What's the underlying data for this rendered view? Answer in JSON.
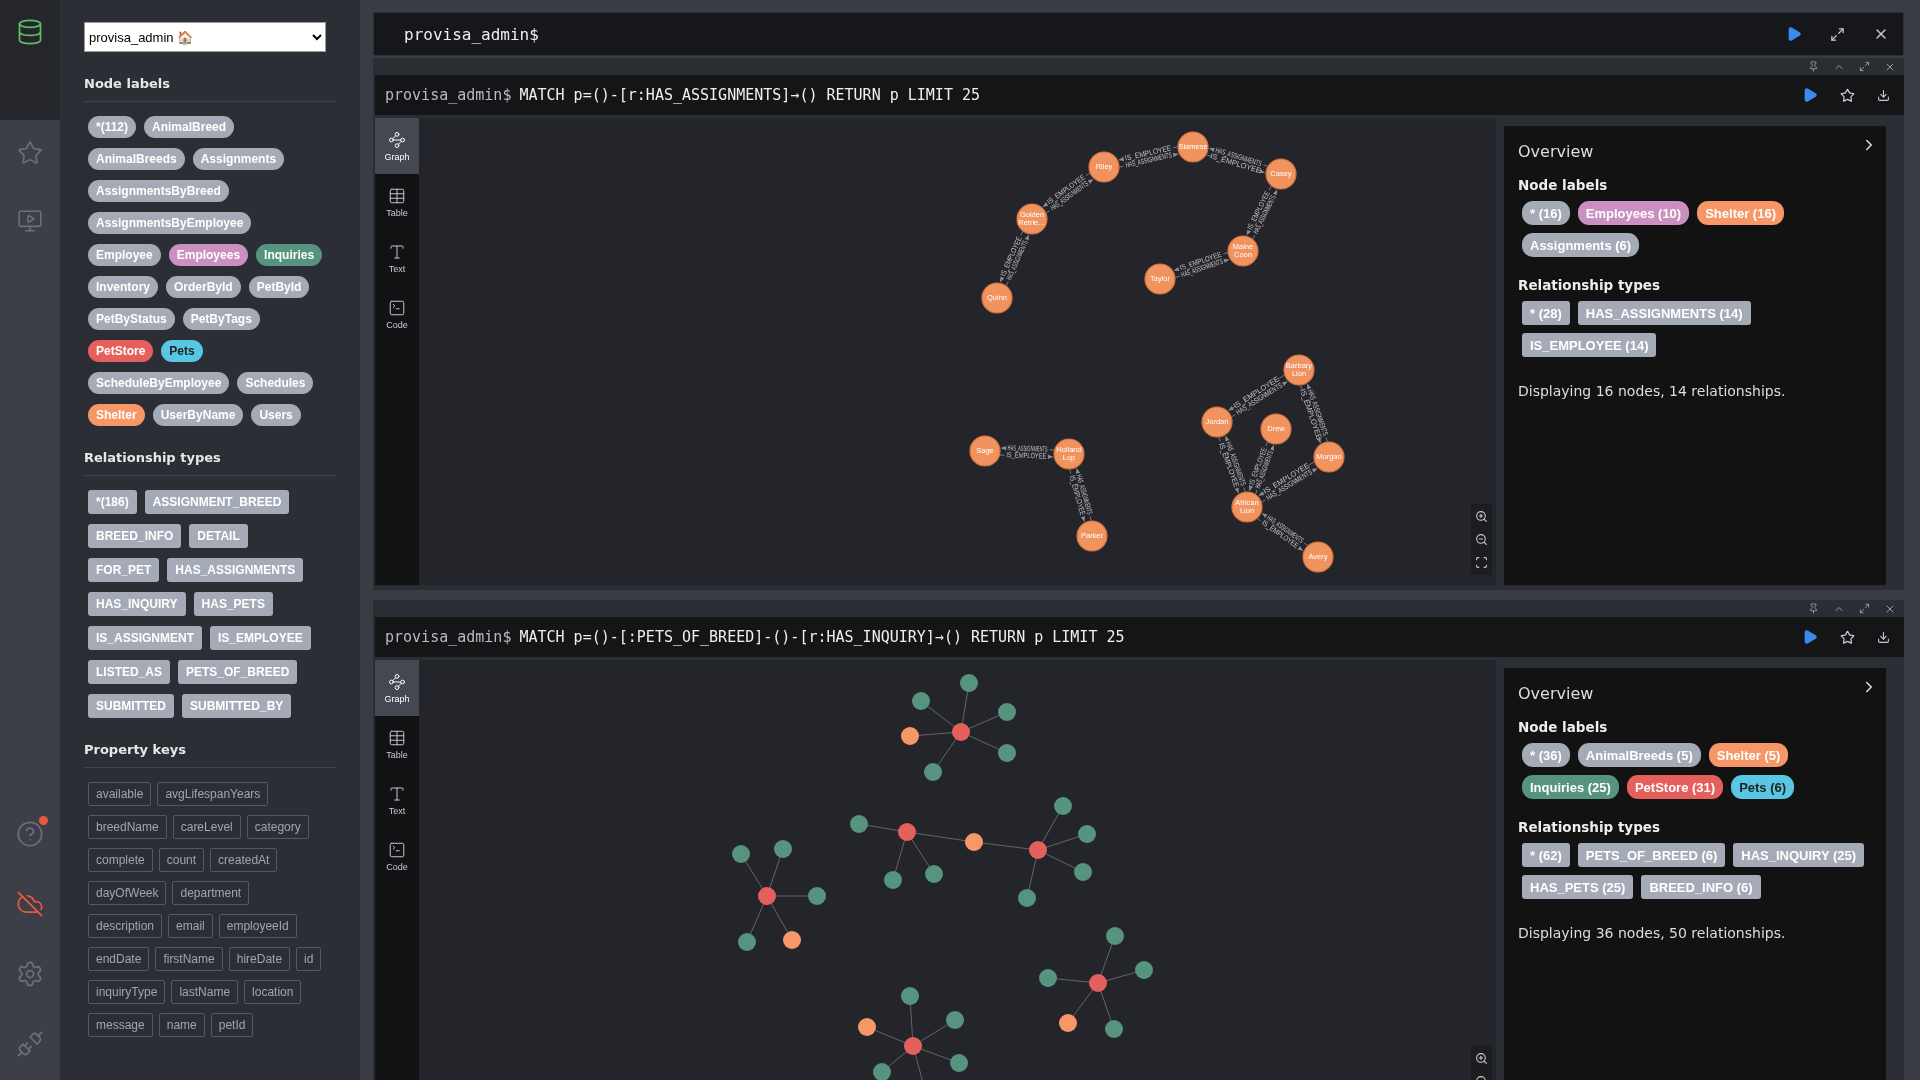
{
  "database_select": {
    "value": "provisa_admin 🏠"
  },
  "sidebar": {
    "sections": [
      {
        "kind": "labels",
        "title": "Node labels",
        "items": [
          {
            "text": "*(112)",
            "color": "#a5abb6"
          },
          {
            "text": "AnimalBreed",
            "color": "#a5abb6"
          },
          {
            "text": "AnimalBreeds",
            "color": "#a5abb6"
          },
          {
            "text": "Assignments",
            "color": "#a5abb6"
          },
          {
            "text": "AssignmentsByBreed",
            "color": "#a5abb6"
          },
          {
            "text": "AssignmentsByEmployee",
            "color": "#a5abb6"
          },
          {
            "text": "Employee",
            "color": "#a5abb6"
          },
          {
            "text": "Employees",
            "color": "#c990c0"
          },
          {
            "text": "Inquiries",
            "color": "#569480"
          },
          {
            "text": "Inventory",
            "color": "#a5abb6"
          },
          {
            "text": "OrderById",
            "color": "#a5abb6"
          },
          {
            "text": "PetById",
            "color": "#a5abb6"
          },
          {
            "text": "PetByStatus",
            "color": "#a5abb6"
          },
          {
            "text": "PetByTags",
            "color": "#a5abb6"
          },
          {
            "text": "PetStore",
            "color": "#e5605c"
          },
          {
            "text": "Pets",
            "color": "#57c7e3"
          },
          {
            "text": "ScheduleByEmployee",
            "color": "#a5abb6"
          },
          {
            "text": "Schedules",
            "color": "#a5abb6"
          },
          {
            "text": "Shelter",
            "color": "#f79767"
          },
          {
            "text": "UserByName",
            "color": "#a5abb6"
          },
          {
            "text": "Users",
            "color": "#a5abb6"
          }
        ]
      },
      {
        "kind": "types",
        "title": "Relationship types",
        "items": [
          {
            "text": "*(186)"
          },
          {
            "text": "ASSIGNMENT_BREED"
          },
          {
            "text": "BREED_INFO"
          },
          {
            "text": "DETAIL"
          },
          {
            "text": "FOR_PET"
          },
          {
            "text": "HAS_ASSIGNMENTS"
          },
          {
            "text": "HAS_INQUIRY"
          },
          {
            "text": "HAS_PETS"
          },
          {
            "text": "IS_ASSIGNMENT"
          },
          {
            "text": "IS_EMPLOYEE"
          },
          {
            "text": "LISTED_AS"
          },
          {
            "text": "PETS_OF_BREED"
          },
          {
            "text": "SUBMITTED"
          },
          {
            "text": "SUBMITTED_BY"
          }
        ]
      },
      {
        "kind": "keys",
        "title": "Property keys",
        "items": [
          {
            "text": "available"
          },
          {
            "text": "avgLifespanYears"
          },
          {
            "text": "breedName"
          },
          {
            "text": "careLevel"
          },
          {
            "text": "category"
          },
          {
            "text": "complete"
          },
          {
            "text": "count"
          },
          {
            "text": "createdAt"
          },
          {
            "text": "dayOfWeek"
          },
          {
            "text": "department"
          },
          {
            "text": "description"
          },
          {
            "text": "email"
          },
          {
            "text": "employeeId"
          },
          {
            "text": "endDate"
          },
          {
            "text": "firstName"
          },
          {
            "text": "hireDate"
          },
          {
            "text": "id"
          },
          {
            "text": "inquiryType"
          },
          {
            "text": "lastName"
          },
          {
            "text": "location"
          },
          {
            "text": "message"
          },
          {
            "text": "name"
          },
          {
            "text": "petId"
          }
        ]
      }
    ]
  },
  "editor": {
    "prompt": "provisa_admin$"
  },
  "frames": [
    {
      "prompt": "provisa_admin$",
      "query": "MATCH p=()-[r:HAS_ASSIGNMENTS]→() RETURN p LIMIT 25",
      "views": [
        {
          "kind": "graph",
          "label": "Graph",
          "selected": true
        },
        {
          "kind": "table",
          "label": "Table",
          "selected": false
        },
        {
          "kind": "text",
          "label": "Text",
          "selected": false
        },
        {
          "kind": "code",
          "label": "Code",
          "selected": false
        }
      ],
      "graph": {
        "kind": "captioned",
        "nodes": [
          {
            "caption": "Siamese"
          },
          {
            "caption": "Riley"
          },
          {
            "caption": "Casey"
          },
          {
            "caption": "Golden Retrie…"
          },
          {
            "caption": "Maine Coon"
          },
          {
            "caption": "Taylor"
          },
          {
            "caption": "Quinn"
          },
          {
            "caption": "Barbary Lion"
          },
          {
            "caption": "Jordan"
          },
          {
            "caption": "Drew"
          },
          {
            "caption": "Sage"
          },
          {
            "caption": "Holland Lop"
          },
          {
            "caption": "Morgan"
          },
          {
            "caption": "African Lion"
          },
          {
            "caption": "Parker"
          },
          {
            "caption": "Avery"
          }
        ],
        "relationships": [
          {
            "type": "IS_EMPLOYEE"
          },
          {
            "type": "HAS_ASSIGNMENTS"
          },
          {
            "type": "IS_EMPLOYEE"
          },
          {
            "type": "HAS_ASSIGNMENTS"
          },
          {
            "type": "IS_EMPLOYEE"
          },
          {
            "type": "HAS_ASSIGNMENTS"
          },
          {
            "type": "IS_EMPLOYEE"
          },
          {
            "type": "HAS_ASSIGNMENTS"
          },
          {
            "type": "IS_EMPLOYEE"
          },
          {
            "type": "HAS_ASSIGNMENTS"
          },
          {
            "type": "IS_EMPLOYEE"
          },
          {
            "type": "HAS_ASSIGNMENTS"
          },
          {
            "type": "IS_EMPLOYEE"
          },
          {
            "type": "HAS_ASSIGNMENTS"
          },
          {
            "type": "IS_EMPLOYEE"
          },
          {
            "type": "HAS_ASSIGNMENTS"
          },
          {
            "type": "IS_EMPLOYEE"
          },
          {
            "type": "HAS_ASSIGNMENTS"
          },
          {
            "type": "IS_EMPLOYEE"
          },
          {
            "type": "HAS_ASSIGNMENTS"
          },
          {
            "type": "IS_EMPLOYEE"
          },
          {
            "type": "HAS_ASSIGNMENTS"
          },
          {
            "type": "IS_EMPLOYEE"
          },
          {
            "type": "HAS_ASSIGNMENTS"
          },
          {
            "type": "IS_EMPLOYEE"
          },
          {
            "type": "HAS_ASSIGNMENTS"
          },
          {
            "type": "IS_EMPLOYEE"
          },
          {
            "type": "HAS_ASSIGNMENTS"
          }
        ]
      },
      "overview": {
        "title": "Overview",
        "labels_title": "Node labels",
        "labels": [
          {
            "text": "* (16)",
            "color": "#a5abb6"
          },
          {
            "text": "Employees (10)",
            "color": "#c990c0"
          },
          {
            "text": "Shelter (16)",
            "color": "#f79767"
          },
          {
            "text": "Assignments (6)",
            "color": "#a5abb6"
          }
        ],
        "types_title": "Relationship types",
        "types": [
          {
            "text": "* (28)"
          },
          {
            "text": "HAS_ASSIGNMENTS (14)"
          },
          {
            "text": "IS_EMPLOYEE (14)"
          }
        ],
        "summary": "Displaying 16 nodes, 14 relationships."
      }
    },
    {
      "prompt": "provisa_admin$",
      "query": "MATCH p=()-[:PETS_OF_BREED]-()-[r:HAS_INQUIRY]→() RETURN p LIMIT 25",
      "views": [
        {
          "kind": "graph",
          "label": "Graph",
          "selected": true
        },
        {
          "kind": "table",
          "label": "Table",
          "selected": false
        },
        {
          "kind": "text",
          "label": "Text",
          "selected": false
        },
        {
          "kind": "code",
          "label": "Code",
          "selected": false
        }
      ],
      "graph": {
        "kind": "clusters"
      },
      "overview": {
        "title": "Overview",
        "labels_title": "Node labels",
        "labels": [
          {
            "text": "* (36)",
            "color": "#a5abb6"
          },
          {
            "text": "AnimalBreeds (5)",
            "color": "#a5abb6"
          },
          {
            "text": "Shelter (5)",
            "color": "#f79767"
          },
          {
            "text": "Inquiries (25)",
            "color": "#569480"
          },
          {
            "text": "PetStore (31)",
            "color": "#e5605c"
          },
          {
            "text": "Pets (6)",
            "color": "#57c7e3"
          }
        ],
        "types_title": "Relationship types",
        "types": [
          {
            "text": "* (62)"
          },
          {
            "text": "PETS_OF_BREED (6)"
          },
          {
            "text": "HAS_INQUIRY (25)"
          },
          {
            "text": "HAS_PETS (25)"
          },
          {
            "text": "BREED_INFO (6)"
          }
        ],
        "summary": "Displaying 36 nodes, 50 relationships."
      }
    }
  ]
}
